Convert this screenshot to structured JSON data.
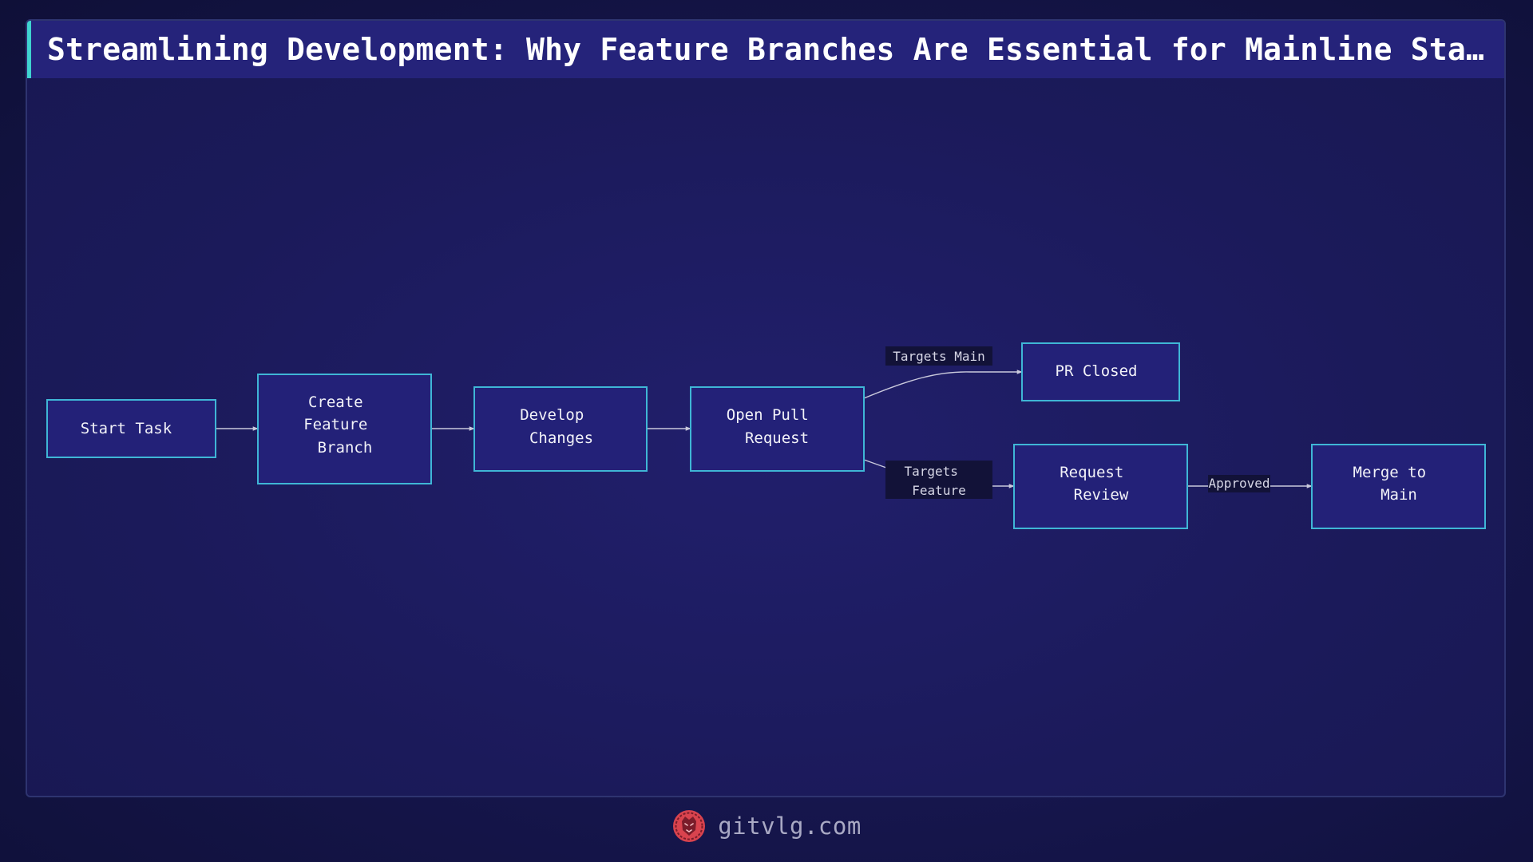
{
  "title": "Streamlining Development: Why Feature Branches Are Essential for Mainline Stabi…",
  "diagram": {
    "nodes": {
      "start_task": [
        "Start Task"
      ],
      "create_feature_branch": [
        "Create",
        "Feature",
        "Branch"
      ],
      "develop_changes": [
        "Develop",
        "Changes"
      ],
      "open_pull_request": [
        "Open Pull",
        "Request"
      ],
      "pr_closed": [
        "PR Closed"
      ],
      "request_review": [
        "Request",
        "Review"
      ],
      "merge_to_main": [
        "Merge to",
        "Main"
      ]
    },
    "edge_labels": {
      "targets_main": [
        "Targets Main"
      ],
      "targets_feature": [
        "Targets",
        "Feature"
      ],
      "approved": [
        "Approved"
      ]
    }
  },
  "footer": {
    "site": "gitvlg.com",
    "logo_icon": "lion-head-icon"
  },
  "colors": {
    "background": "#15154a",
    "panel": "#1b1a5a",
    "title_bar": "#25237a",
    "accent": "#3fd3d0",
    "node_fill": "#232178",
    "node_border": "#3fb6d6",
    "edge": "#c9c9dc",
    "label_bg": "#121238",
    "logo": "#d9434e"
  }
}
